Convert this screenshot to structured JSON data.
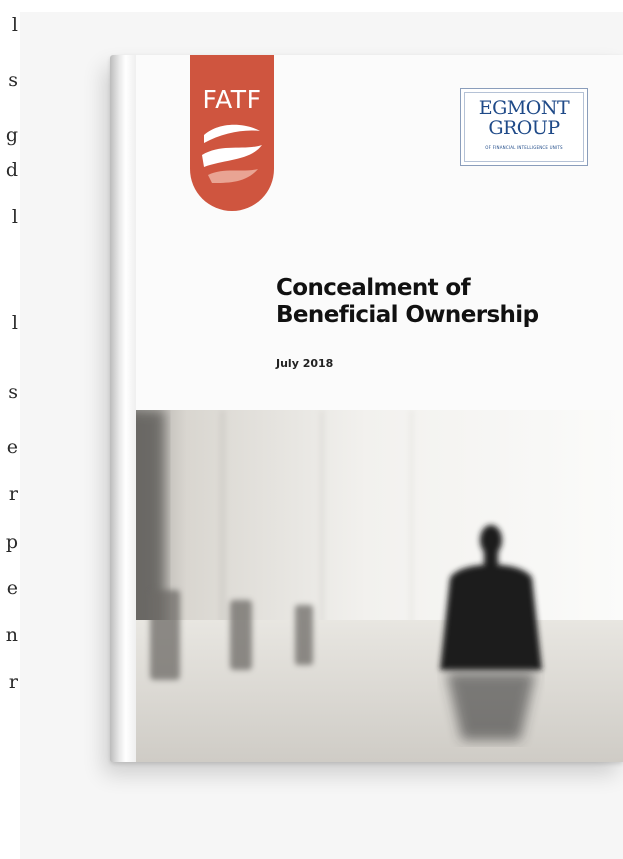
{
  "body_text_fragments": [
    "l",
    "s",
    "g",
    "d",
    "l",
    "l",
    "s",
    "e",
    "r",
    "p",
    "e",
    "n",
    "r"
  ],
  "cover": {
    "fatf_logo": "FATF",
    "egmont_logo_line1": "EGMONT",
    "egmont_logo_line2": "GROUP",
    "egmont_logo_tagline": "OF FINANCIAL INTELLIGENCE UNITS",
    "title_line1": "Concealment of",
    "title_line2": "Beneficial Ownership",
    "date": "July 2018"
  },
  "colors": {
    "fatf_orange": "#cf553f",
    "egmont_blue": "#1f4a88",
    "panel_grey": "#f6f6f6"
  }
}
